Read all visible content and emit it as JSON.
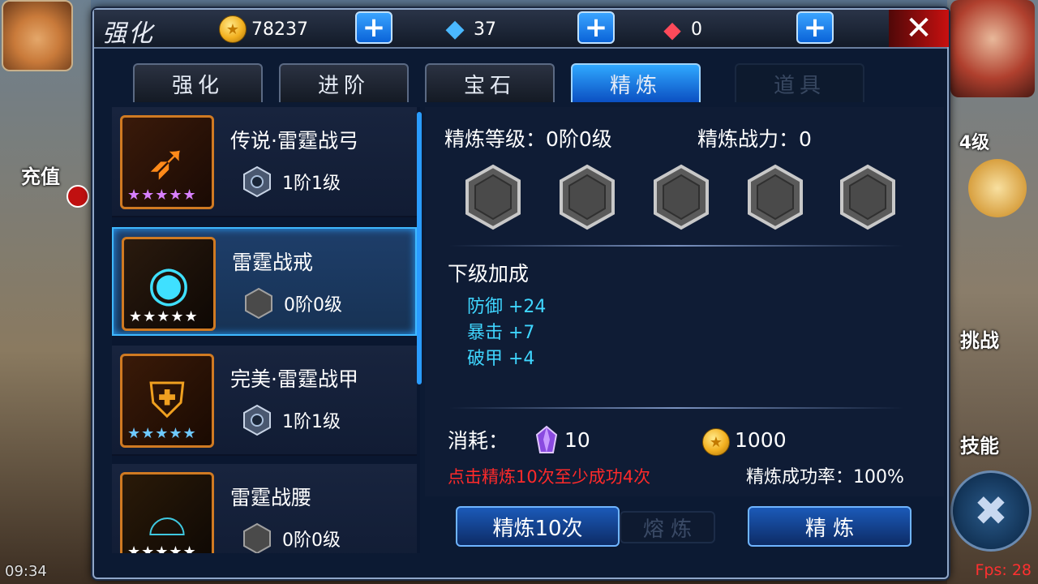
{
  "background": {
    "left_label_1": "充值",
    "right_level": "4级",
    "right_label_1": "挑战",
    "right_label_2": "技能",
    "clock": "09:34",
    "fps": "Fps: 28"
  },
  "header": {
    "title": "强化",
    "gold": "78237",
    "diamonds": "37",
    "red_gems": "0"
  },
  "tabs": [
    {
      "label": "强化",
      "state": "normal"
    },
    {
      "label": "进阶",
      "state": "normal"
    },
    {
      "label": "宝石",
      "state": "normal"
    },
    {
      "label": "精炼",
      "state": "active"
    },
    {
      "label": "道具",
      "state": "disabled"
    }
  ],
  "equipment": [
    {
      "name": "传说·雷霆战弓",
      "level": "1阶1级",
      "stars": "★★★★★",
      "star_color": "#d880ff",
      "icon": "bow-icon",
      "selected": false
    },
    {
      "name": "雷霆战戒",
      "level": "0阶0级",
      "stars": "★★★★★",
      "star_color": "#ffffff",
      "icon": "ring-icon",
      "selected": true
    },
    {
      "name": "完美·雷霆战甲",
      "level": "1阶1级",
      "stars": "★★★★★",
      "star_color": "#6ec8ff",
      "icon": "armor-icon",
      "selected": false
    },
    {
      "name": "雷霆战腰",
      "level": "0阶0级",
      "stars": "★★★★★",
      "star_color": "#ffffff",
      "icon": "belt-icon",
      "selected": false
    }
  ],
  "refine": {
    "level_label": "精炼等级：0阶0级",
    "power_label": "精炼战力：0",
    "slots": 5,
    "next_bonus_title": "下级加成",
    "bonuses": [
      "防御 +24",
      "暴击 +7",
      "破甲 +4"
    ],
    "cost_label": "消耗：",
    "crystal_cost": "10",
    "gold_cost": "1000",
    "hint": "点击精炼10次至少成功4次",
    "success_rate": "精炼成功率：100%"
  },
  "buttons": {
    "refine_ten": "精炼10次",
    "smelt": "熔 炼",
    "refine": "精 炼"
  }
}
